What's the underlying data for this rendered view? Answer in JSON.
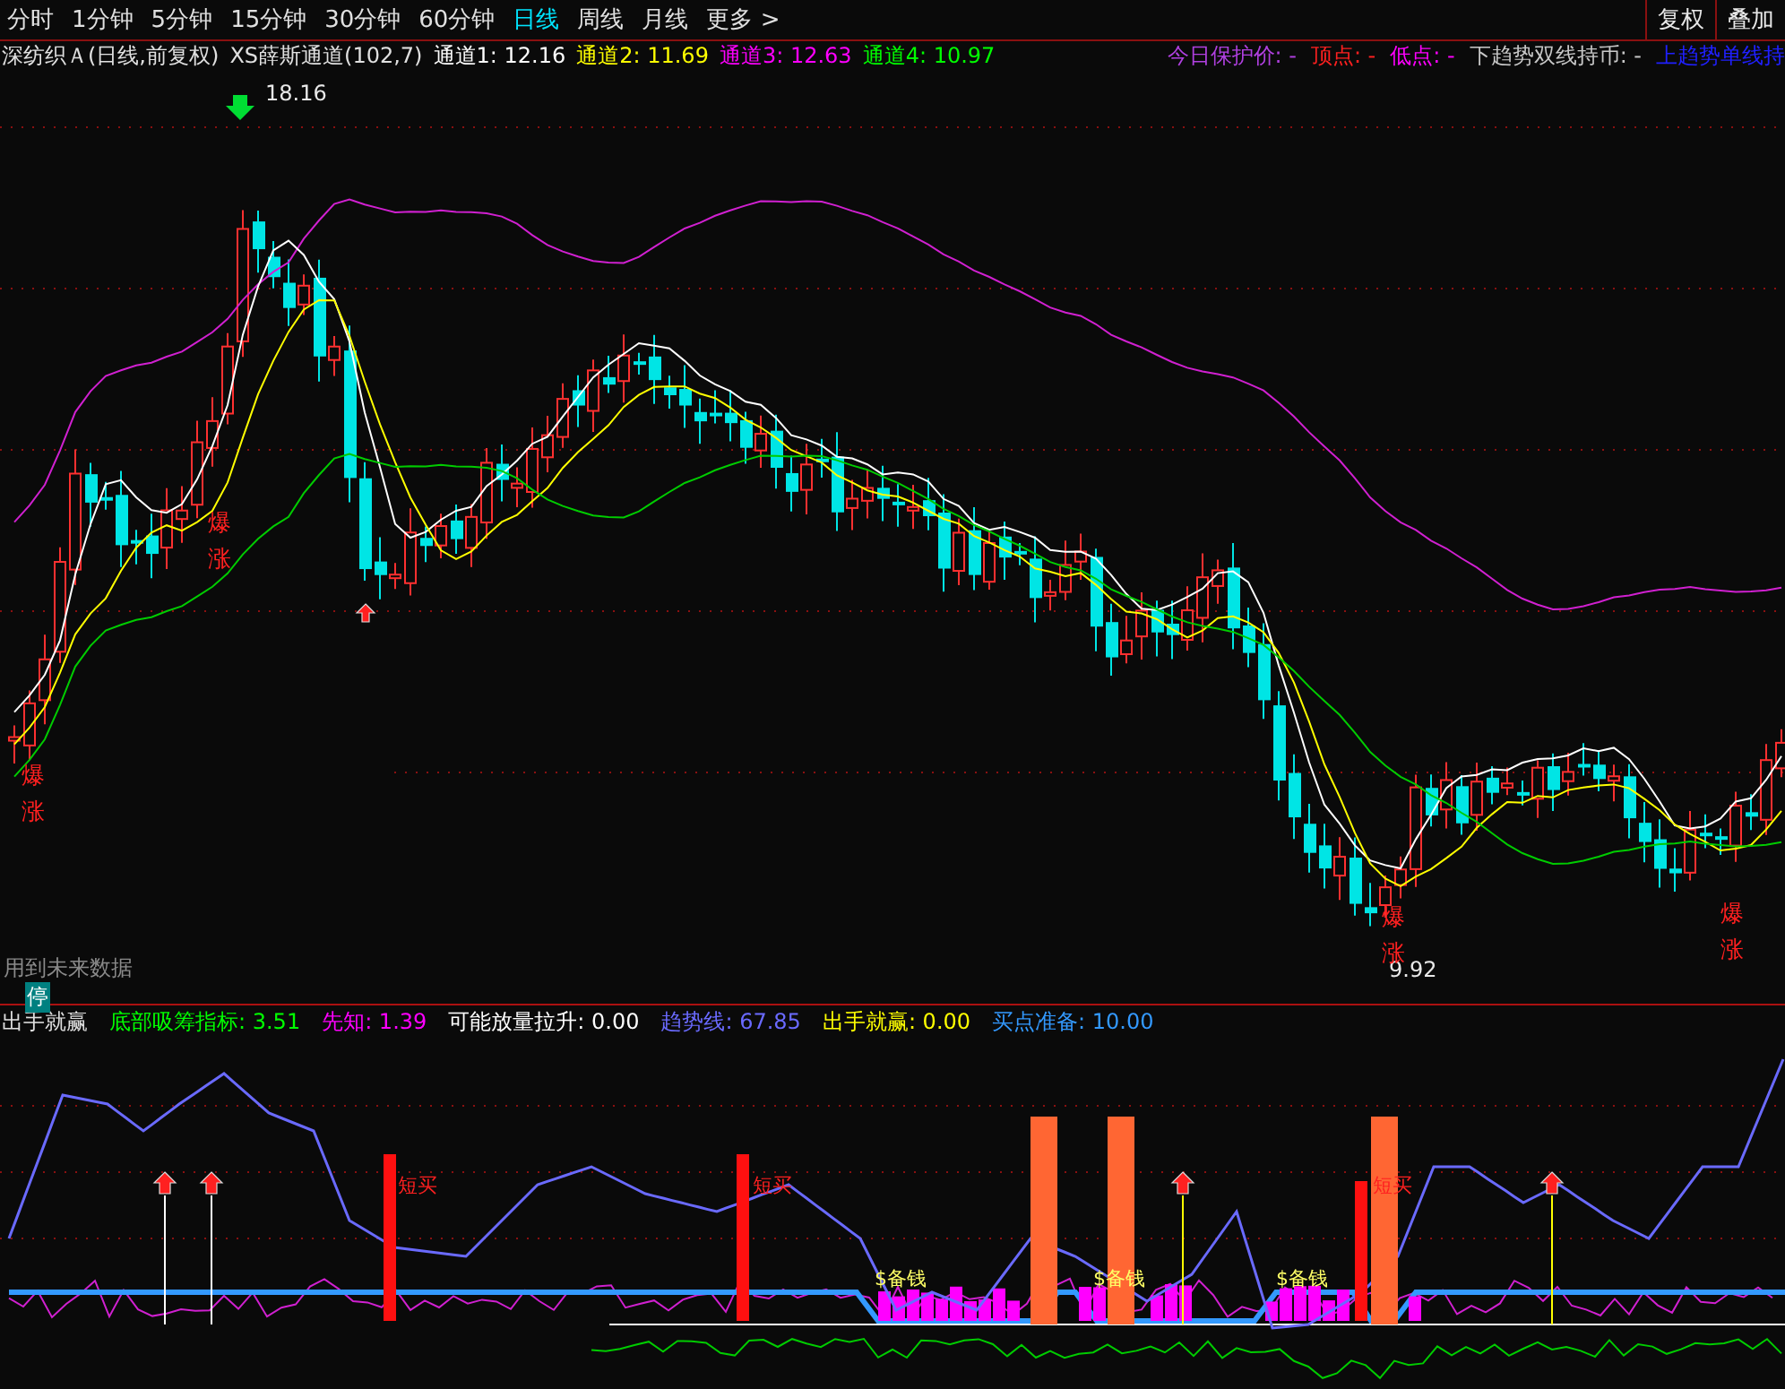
{
  "toolbar": {
    "periods": [
      {
        "label": "分时",
        "selected": false
      },
      {
        "label": "1分钟",
        "selected": false
      },
      {
        "label": "5分钟",
        "selected": false
      },
      {
        "label": "15分钟",
        "selected": false
      },
      {
        "label": "30分钟",
        "selected": false
      },
      {
        "label": "60分钟",
        "selected": false
      },
      {
        "label": "日线",
        "selected": true
      },
      {
        "label": "周线",
        "selected": false
      },
      {
        "label": "月线",
        "selected": false
      }
    ],
    "more": "更多 >",
    "buttons": [
      "复权",
      "叠加"
    ]
  },
  "main_chart": {
    "stock_title": "深纺织Ａ(日线,前复权)",
    "indicator_name": "XS薛斯通道(102,7)",
    "legend": [
      {
        "label": "通道1: 12.16",
        "color": "#ffffff"
      },
      {
        "label": "通道2: 11.69",
        "color": "#ffff00"
      },
      {
        "label": "通道3: 12.63",
        "color": "#ff00ff"
      },
      {
        "label": "通道4: 10.97",
        "color": "#00ff00"
      }
    ],
    "info": [
      {
        "label": "今日保护价: -",
        "color": "#b040e0"
      },
      {
        "label": "顶点: -",
        "color": "#ff2020"
      },
      {
        "label": "低点: -",
        "color": "#ff00ff"
      },
      {
        "label": "下趋势双线持币: -",
        "color": "#c8c8c8"
      },
      {
        "label": "上趋势单线持",
        "color": "#2020ff"
      }
    ],
    "high_label": "18.16",
    "low_label": "9.92",
    "signals": [
      {
        "line1": "爆",
        "line2": "涨"
      },
      {
        "line1": "爆",
        "line2": "涨"
      },
      {
        "line1": "爆",
        "line2": "涨"
      },
      {
        "line1": "爆",
        "line2": "涨"
      }
    ],
    "future_data_note": "用到未来数据",
    "halt_badge": "停"
  },
  "sub_chart": {
    "title": "出手就赢",
    "legend": [
      {
        "label": "底部吸筹指标: 3.51",
        "color": "#00ff00"
      },
      {
        "label": "先知: 1.39",
        "color": "#ff00ff"
      },
      {
        "label": "可能放量拉升: 0.00",
        "color": "#ffffff"
      },
      {
        "label": "趋势线: 67.85",
        "color": "#6a6aff"
      },
      {
        "label": "出手就赢: 0.00",
        "color": "#ffff00"
      },
      {
        "label": "买点准备: 10.00",
        "color": "#3399ff"
      }
    ],
    "buy_labels": [
      "短买",
      "短买",
      "短买"
    ],
    "money_labels": [
      "$备钱",
      "$备钱",
      "$备钱"
    ]
  }
}
